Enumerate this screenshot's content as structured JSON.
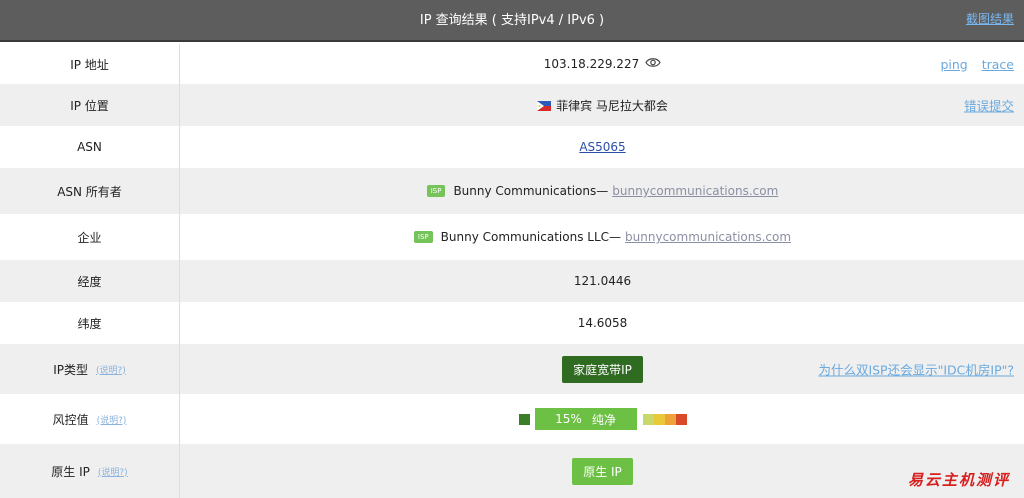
{
  "header": {
    "title": "IP 查询结果 ( 支持IPv4 / IPv6 )",
    "screenshot_link": "截图结果"
  },
  "rows": {
    "ip": {
      "label": "IP 地址",
      "value": "103.18.229.227",
      "ping": "ping",
      "trace": "trace"
    },
    "location": {
      "label": "IP 位置",
      "value": "菲律宾 马尼拉大都会",
      "report": "错误提交"
    },
    "asn": {
      "label": "ASN",
      "value": "AS5065"
    },
    "asn_owner": {
      "label": "ASN 所有者",
      "badge": "ISP",
      "name": "Bunny Communications—",
      "domain": "bunnycommunications.com"
    },
    "company": {
      "label": "企业",
      "badge": "ISP",
      "name": "Bunny Communications LLC—",
      "domain": "bunnycommunications.com"
    },
    "longitude": {
      "label": "经度",
      "value": "121.0446"
    },
    "latitude": {
      "label": "纬度",
      "value": "14.6058"
    },
    "ip_type": {
      "label": "IP类型",
      "hint": "(说明?)",
      "value": "家庭宽带IP",
      "question": "为什么双ISP还会显示\"IDC机房IP\"?"
    },
    "risk": {
      "label": "风控值",
      "hint": "(说明?)",
      "percent": "15%",
      "text": "纯净",
      "level": 0.15
    },
    "native": {
      "label": "原生 IP",
      "hint": "(说明?)",
      "value": "原生 IP"
    }
  },
  "colors": {
    "risk_scale": [
      "#c8d86a",
      "#e8c93a",
      "#f0a23a",
      "#d94a2a"
    ]
  },
  "watermark": "易云主机测评"
}
